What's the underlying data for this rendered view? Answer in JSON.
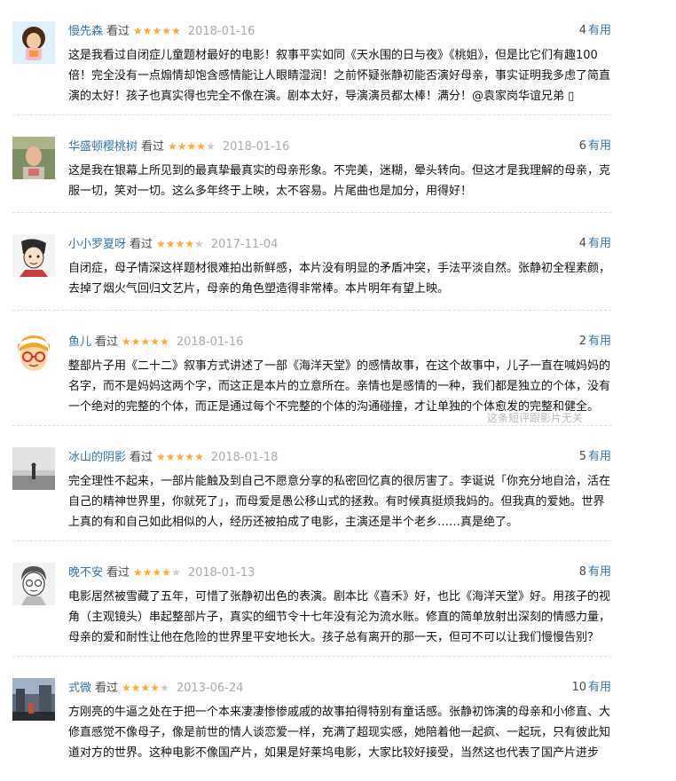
{
  "vote_suffix": "有用",
  "reviews": [
    {
      "user": "慢先森",
      "watched": "看过",
      "stars": 5,
      "date": "2018-01-16",
      "votes": "4",
      "avatar": "cartoon-avatar",
      "content": "这是我看过自闭症儿童题材最好的电影！叙事平实如同《天水围的日与夜》《桃姐》，但是比它们有趣100倍！完全没有一点煽情却饱含感情能让人眼睛湿润！之前怀疑张静初能否演好母亲，事实证明我多虑了简直演的太好！孩子也真实得也完全不像在演。剧本太好，导演演员都太棒！满分！@袁家岗华谊兄弟 ▯"
    },
    {
      "user": "华盛顿樱桃树",
      "watched": "看过",
      "stars": 4,
      "date": "2018-01-16",
      "votes": "6",
      "avatar": "photo-avatar",
      "content": "这是我在银幕上所见到的最真挚最真实的母亲形象。不完美，迷糊，晕头转向。但这才是我理解的母亲，克服一切，笑对一切。这么多年终于上映，太不容易。片尾曲也是加分，用得好！"
    },
    {
      "user": "小小罗夏呀",
      "watched": "看过",
      "stars": 4,
      "date": "2017-11-04",
      "votes": "4",
      "avatar": "drawing-avatar",
      "content": "自闭症，母子情深这样题材很难拍出新鲜感，本片没有明显的矛盾冲突，手法平淡自然。张静初全程素颜，去掉了烟火气回归文艺片，母亲的角色塑造得非常棒。本片明年有望上映。"
    },
    {
      "user": "鱼儿",
      "watched": "看过",
      "stars": 5,
      "date": "2018-01-16",
      "votes": "2",
      "avatar": "glasses-avatar",
      "content": "整部片子用《二十二》叙事方式讲述了一部《海洋天堂》的感情故事，在这个故事中，儿子一直在喊妈妈的名字，而不是妈妈这两个字，而这正是本片的立意所在。亲情也是感情的一种，我们都是独立的个体，没有一个绝对的完整的个体，而正是通过每个不完整的个体的沟通碰撞，才让单独的个体愈发的完整和健全。",
      "note": "这条短评跟影片无关"
    },
    {
      "user": "冰山的阴影",
      "watched": "看过",
      "stars": 5,
      "date": "2018-01-18",
      "votes": "5",
      "avatar": "mist-avatar",
      "content": "完全理性不起来，一部片能触及到自己不愿意分享的私密回忆真的很厉害了。李诞说「你充分地自洽，活在自己的精神世界里，你就死了」，而母爱是愚公移山式的拯救。有时候真挺烦我妈的。但我真的爱她。世界上真的有和自己如此相似的人，经历还被拍成了电影，主演还是半个老乡……真是绝了。"
    },
    {
      "user": "晚不安",
      "watched": "看过",
      "stars": 4,
      "date": "2018-01-13",
      "votes": "8",
      "avatar": "sketch-avatar",
      "content": "电影居然被雪藏了五年，可惜了张静初出色的表演。剧本比《喜禾》好，也比《海洋天堂》好。用孩子的视角（主观镜头）串起整部片子，真实的细节令十七年没有沦为流水账。修直的简单放射出深刻的情感力量，母亲的爱和耐性让他在危险的世界里平安地长大。孩子总有离开的那一天，但可不可以让我们慢慢告别？"
    },
    {
      "user": "式微",
      "watched": "看过",
      "stars": 4,
      "date": "2013-06-24",
      "votes": "10",
      "avatar": "street-avatar",
      "content": "方刚亮的牛逼之处在于把一个本来凄凄惨惨戚戚的故事拍得特别有童话感。张静初饰演的母亲和小修直、大修直感觉不像母子，像是前世的情人谈恋爱一样，充满了超现实感，她陪着他一起疯、一起玩，只有彼此知道对方的世界。这种电影不像国产片，如果是好莱坞电影，大家比较好接受，当然这也代表了国产片进步"
    }
  ]
}
